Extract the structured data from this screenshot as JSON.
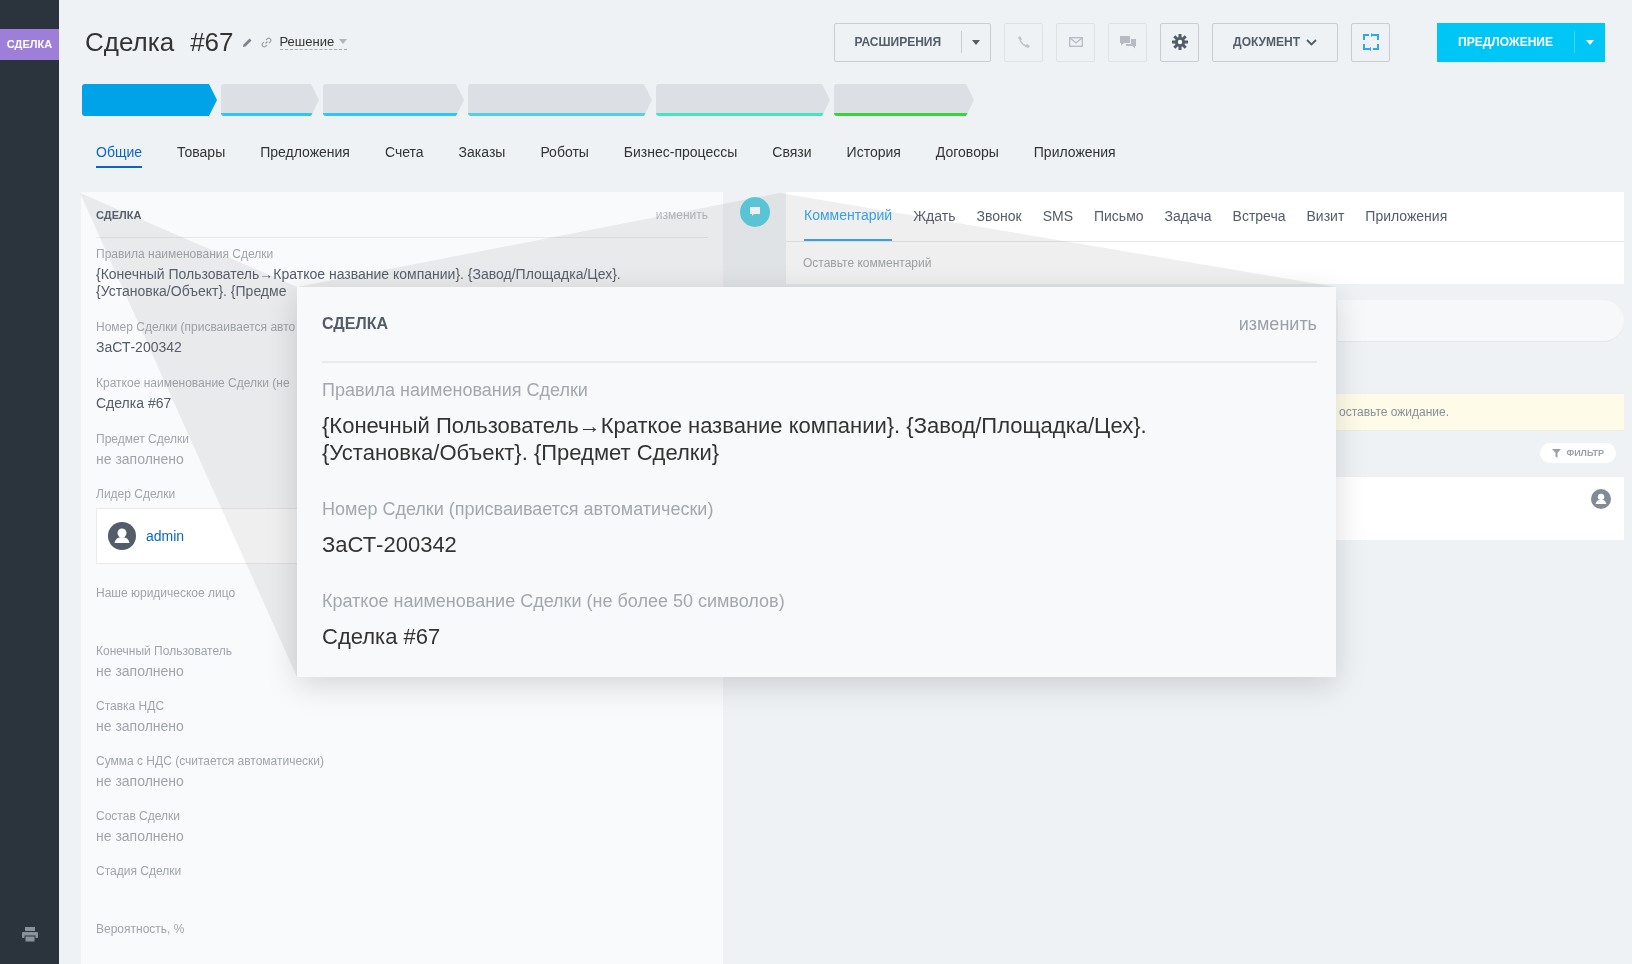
{
  "sidebar": {
    "badge": "СДЕЛКА"
  },
  "header": {
    "title": "Сделка",
    "number": "#67",
    "category": "Решение"
  },
  "toolbar": {
    "extensions": "РАСШИРЕНИЯ",
    "document": "ДОКУМЕНТ",
    "primary": "ПРЕДЛОЖЕНИЕ"
  },
  "stages": [
    {
      "selected": true,
      "color": "#00a2e8"
    },
    {
      "selected": false,
      "color": "#2fc6f6"
    },
    {
      "selected": false,
      "color": "#2fc6f6"
    },
    {
      "selected": false,
      "color": "#55d0e0"
    },
    {
      "selected": false,
      "color": "#47e4c2"
    },
    {
      "selected": false,
      "color": "#3bd33b"
    }
  ],
  "tabs": [
    {
      "label": "Общие",
      "selected": true
    },
    {
      "label": "Товары",
      "selected": false
    },
    {
      "label": "Предложения",
      "selected": false
    },
    {
      "label": "Счета",
      "selected": false
    },
    {
      "label": "Заказы",
      "selected": false
    },
    {
      "label": "Роботы",
      "selected": false
    },
    {
      "label": "Бизнес-процессы",
      "selected": false
    },
    {
      "label": "Связи",
      "selected": false
    },
    {
      "label": "История",
      "selected": false
    },
    {
      "label": "Договоры",
      "selected": false
    },
    {
      "label": "Приложения",
      "selected": false
    }
  ],
  "deal_panel": {
    "title": "СДЕЛКА",
    "edit": "изменить",
    "fields": [
      {
        "kind": "text",
        "label": "Правила наименования Сделки",
        "value": "{Конечный Пользователь→Краткое название компании}. {Завод/Площадка/Цех}.\n{Установка/Объект}. {Предме"
      },
      {
        "kind": "text",
        "label": "Номер Сделки (присваивается авто",
        "value": "ЗаСТ-200342"
      },
      {
        "kind": "text",
        "label": "Краткое наименование Сделки (не",
        "value": "Сделка #67"
      },
      {
        "kind": "empty",
        "label": "Предмет Сделки",
        "value": "не заполнено"
      },
      {
        "kind": "user",
        "label": "Лидер Сделки",
        "value": "admin"
      },
      {
        "kind": "blank",
        "label": "Наше юридическое лицо"
      },
      {
        "kind": "empty",
        "label": "Конечный Пользователь",
        "value": "не заполнено"
      },
      {
        "kind": "empty",
        "label": "Ставка НДС",
        "value": "не заполнено"
      },
      {
        "kind": "empty",
        "label": "Сумма с НДС (считается автоматически)",
        "value": "не заполнено"
      },
      {
        "kind": "empty",
        "label": "Состав Сделки",
        "value": "не заполнено"
      },
      {
        "kind": "blank",
        "label": "Стадия Сделки"
      },
      {
        "kind": "blank",
        "label": "Вероятность, %"
      }
    ]
  },
  "timeline": {
    "tabs": [
      {
        "label": "Комментарий",
        "selected": true
      },
      {
        "label": "Ждать",
        "selected": false
      },
      {
        "label": "Звонок",
        "selected": false
      },
      {
        "label": "SMS",
        "selected": false
      },
      {
        "label": "Письмо",
        "selected": false
      },
      {
        "label": "Задача",
        "selected": false
      },
      {
        "label": "Встреча",
        "selected": false
      },
      {
        "label": "Визит",
        "selected": false
      },
      {
        "label": "Приложения",
        "selected": false
      }
    ],
    "placeholder": "Оставьте комментарий",
    "note": "оставьте ожидание.",
    "filter": "ФИЛЬТР"
  },
  "callout": {
    "title": "СДЕЛКА",
    "edit": "изменить",
    "fields": [
      {
        "label": "Правила наименования Сделки",
        "value": "{Конечный Пользователь→Краткое название компании}. {Завод/Площадка/Цех}.\n{Установка/Объект}. {Предмет Сделки}"
      },
      {
        "label": "Номер Сделки (присваивается автоматически)",
        "value": "ЗаСТ-200342"
      },
      {
        "label": "Краткое наименование Сделки (не более 50 символов)",
        "value": "Сделка #67"
      }
    ]
  }
}
